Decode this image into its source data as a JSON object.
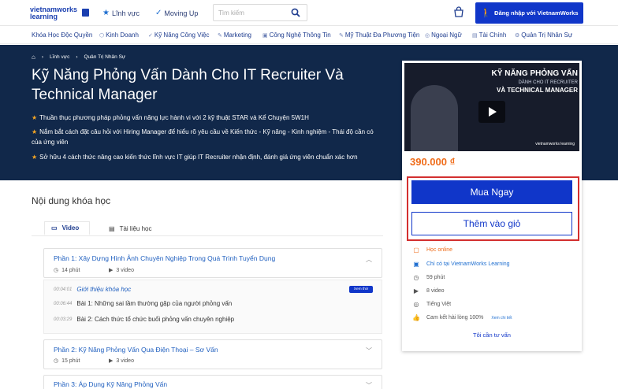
{
  "header": {
    "logo_line1": "vietnamworks",
    "logo_line2": "learning",
    "nav1": "Lĩnh vực",
    "nav2": "Moving Up",
    "search_placeholder": "Tìm kiếm",
    "login": "Đăng nhập với VietnamWorks"
  },
  "categories": [
    {
      "icon": "",
      "label": "Khóa Học Độc Quyền"
    },
    {
      "icon": "⬡",
      "label": "Kinh Doanh"
    },
    {
      "icon": "✓",
      "label": "Kỹ Năng Công Việc"
    },
    {
      "icon": "✎",
      "label": "Marketing"
    },
    {
      "icon": "▣",
      "label": "Công Nghệ Thông Tin"
    },
    {
      "icon": "✎",
      "label": "Mỹ Thuật Đa Phương Tiện"
    },
    {
      "icon": "◎",
      "label": "Ngoại Ngữ"
    },
    {
      "icon": "▤",
      "label": "Tài Chính"
    },
    {
      "icon": "⚙",
      "label": "Quản Trị Nhân Sự"
    }
  ],
  "breadcrumb": {
    "level1": "Lĩnh vực",
    "level2": "Quản Trị Nhân Sự"
  },
  "course": {
    "title": "Kỹ Năng Phỏng Vấn Dành Cho IT Recruiter Và Technical Manager",
    "bullets": [
      "Thuần thục phương pháp phỏng vấn năng lực hành vi với 2 kỹ thuật STAR và Kể Chuyện 5W1H",
      "Nắm bắt cách đặt câu hỏi với Hiring Manager để hiểu rõ yêu cầu về Kiến thức - Kỹ năng - Kinh nghiệm - Thái độ cần có của ứng viên",
      "Sở hữu 4 cách thức nâng cao kiến thức lĩnh vực IT giúp IT Recruiter nhận định, đánh giá ứng viên chuẩn xác hơn"
    ]
  },
  "card": {
    "thumb_title": "KỸ NĂNG PHỎNG VẤN",
    "thumb_sub1": "DÀNH CHO IT RECRUITER",
    "thumb_sub2": "VÀ TECHNICAL MANAGER",
    "thumb_brand": "vietnamworks learning",
    "price": "390.000 ₫",
    "buy": "Mua Ngay",
    "add": "Thêm vào giỏ",
    "features": [
      "Học online",
      "Chỉ có tại VietnamWorks Learning",
      "59 phút",
      "8 video",
      "Tiếng Việt",
      "Cam kết hài lòng 100%"
    ],
    "feature_sub": "Xem chi tiết",
    "contact": "Tôi cần tư vấn"
  },
  "content": {
    "heading": "Nội dung khóa học",
    "tab_video": "Video",
    "tab_docs": "Tài liệu học",
    "sections": [
      {
        "title": "Phần 1: Xây Dựng Hình Ảnh Chuyên Nghiệp Trong Quá Trình Tuyển Dụng",
        "duration": "14 phút",
        "videos": "3 video"
      },
      {
        "title": "Phần 2: Kỹ Năng Phỏng Vấn Qua Điện Thoại – Sơ Vấn",
        "duration": "15 phút",
        "videos": "3 video"
      },
      {
        "title": "Phần 3: Áp Dụng Kỹ Năng Phỏng Vấn",
        "duration": "",
        "videos": ""
      }
    ],
    "lessons": [
      {
        "time": "00:04:01",
        "title": "Giới thiệu khóa học",
        "badge": "Xem thử"
      },
      {
        "time": "00:06:44",
        "title": "Bài 1: Những sai lầm thường gặp của người phỏng vấn"
      },
      {
        "time": "00:03:29",
        "title": "Bài 2: Cách thức tổ chức buổi phỏng vấn chuyên nghiệp"
      }
    ]
  },
  "colors": {
    "accent": "#1036c9",
    "hero": "#11284a",
    "price": "#ef6c1a",
    "highlight_box": "#d32f2f"
  }
}
